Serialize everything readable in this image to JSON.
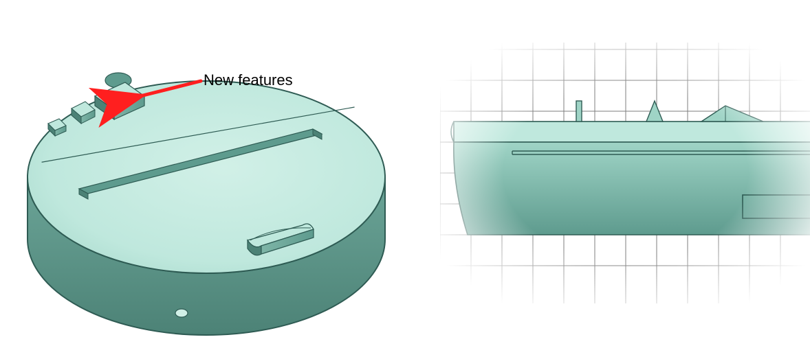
{
  "annotation": {
    "label": "New features"
  },
  "colors": {
    "face_light": "#BFE8DD",
    "face_mid": "#9FD4C6",
    "face_dark": "#5E9B8E",
    "edge": "#2E5B53",
    "grid": "#7E7E7E",
    "arrow": "#FF1F1F",
    "background": "#FFFFFF"
  },
  "views": {
    "iso": {
      "desc": "Isometric view of circular base with features raised on top surface"
    },
    "front": {
      "desc": "Front elevation with grid background"
    }
  }
}
